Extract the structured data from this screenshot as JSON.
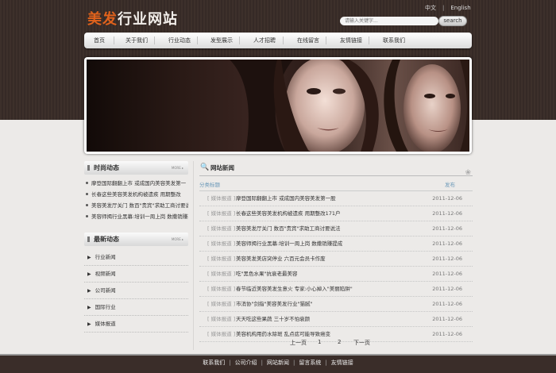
{
  "colors": {
    "accent": "#e0621c",
    "header_bg": "#3d302b",
    "link_blue": "#6a98b8"
  },
  "logo": {
    "accent_text": "美发",
    "text": "行业网站"
  },
  "lang": {
    "zh": "中文",
    "en": "English",
    "sep": "|"
  },
  "search": {
    "placeholder": "请输入关键字...",
    "button": "search"
  },
  "nav": [
    "首页",
    "关于我们",
    "行业动态",
    "发型展示",
    "人才招聘",
    "在线留言",
    "友情链接",
    "联系我们"
  ],
  "left": {
    "trend_title": "时尚动态",
    "more": "MORE ▸",
    "trend_items": [
      "摩登国际翻翻上市 或成国内美容美发第一",
      "长春这些美容美发机构被遗疾 用期整改",
      "美容美发厅关门 数百\"贵宾\"求助工商讨要说",
      "美容师揭行业黑幕:培训一周上岗 数撒销赚提"
    ],
    "latest_title": "最新动态",
    "categories": [
      "行业新闻",
      "视频新闻",
      "公司新闻",
      "国际行业",
      "媒体报道"
    ]
  },
  "right": {
    "title": "网站新闻",
    "col_category": "分类标题",
    "col_date": "发布",
    "rows": [
      {
        "tag": "[ 媒体报道 ]",
        "title": "摩登国际翻翻上市 或成国内美容美发第一股",
        "date": "2011-12-06"
      },
      {
        "tag": "[ 媒体报道 ]",
        "title": "长春这些美容美发机构被遗疾 用期整改171户",
        "date": "2011-12-06"
      },
      {
        "tag": "[ 媒体报道 ]",
        "title": "美容美发厅关门 数百\"贵宾\"求助工商讨要说法",
        "date": "2011-12-06"
      },
      {
        "tag": "[ 媒体报道 ]",
        "title": "美容师揭行业黑幕:培训一周上岗 数撒销赚提成",
        "date": "2011-12-06"
      },
      {
        "tag": "[ 媒体报道 ]",
        "title": "美容美发美店突停业 六百元会员卡作废",
        "date": "2011-12-06"
      },
      {
        "tag": "[ 媒体报道 ]",
        "title": "吃\"黑色水果\"抗衰老最美容",
        "date": "2011-12-06"
      },
      {
        "tag": "[ 媒体报道 ]",
        "title": "春节临近美容美发生意火 专家:小心掉入\"美丽陷阱\"",
        "date": "2011-12-06"
      },
      {
        "tag": "[ 媒体报道 ]",
        "title": "市消协\"剑指\"美容美发行业\"猫腻\"",
        "date": "2011-12-06"
      },
      {
        "tag": "[ 媒体报道 ]",
        "title": "天天吃这些果蔬 三十岁不怕衰颜",
        "date": "2011-12-06"
      },
      {
        "tag": "[ 媒体报道 ]",
        "title": "美容机构用药水除斑 乱点痣可能导致癌变",
        "date": "2011-12-06"
      }
    ],
    "pager": {
      "prev": "上一页",
      "p1": "1",
      "p2": "2",
      "next": "下一页"
    }
  },
  "footer": [
    "联系我们",
    "公司介绍",
    "网站新闻",
    "留言系统",
    "友情链接"
  ]
}
